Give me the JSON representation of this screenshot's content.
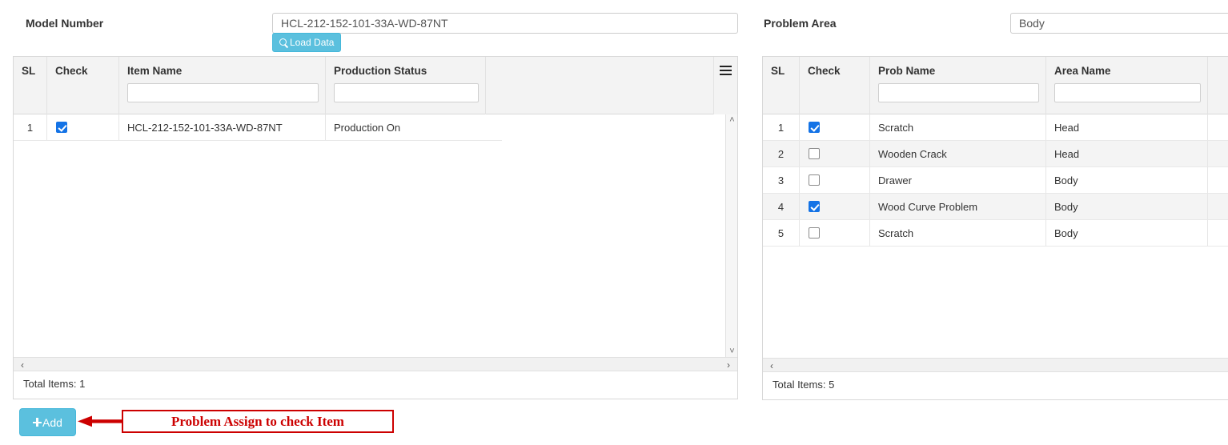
{
  "left_form": {
    "label": "Model Number",
    "value": "HCL-212-152-101-33A-WD-87NT",
    "placeholder": "",
    "load_button_label": "Load Data",
    "load_button_icon": "search-icon",
    "button_color": "#5bc0de"
  },
  "right_form": {
    "label": "Problem Area",
    "value": "Body",
    "placeholder": ""
  },
  "left_grid": {
    "menu_icon": "hamburger-menu-icon",
    "columns": [
      {
        "title": "SL",
        "filter": "",
        "has_filter": false
      },
      {
        "title": "Check",
        "filter": "",
        "has_filter": false
      },
      {
        "title": "Item Name",
        "filter": "",
        "has_filter": true
      },
      {
        "title": "Production Status",
        "filter": "",
        "has_filter": true
      }
    ],
    "rows": [
      {
        "sl": "1",
        "checked": true,
        "item_name": "HCL-212-152-101-33A-WD-87NT",
        "production_status": "Production On"
      }
    ],
    "footer": "Total Items: 1",
    "scroll_left_arrow": "‹",
    "scroll_right_arrow": "›",
    "scroll_up_arrow": "˄",
    "scroll_down_arrow": "˅"
  },
  "right_grid": {
    "columns": [
      {
        "title": "SL",
        "filter": "",
        "has_filter": false
      },
      {
        "title": "Check",
        "filter": "",
        "has_filter": false
      },
      {
        "title": "Prob Name",
        "filter": "",
        "has_filter": true
      },
      {
        "title": "Area Name",
        "filter": "",
        "has_filter": true
      }
    ],
    "rows": [
      {
        "sl": "1",
        "checked": true,
        "prob_name": "Scratch",
        "area_name": "Head"
      },
      {
        "sl": "2",
        "checked": false,
        "prob_name": "Wooden Crack",
        "area_name": "Head"
      },
      {
        "sl": "3",
        "checked": false,
        "prob_name": "Drawer",
        "area_name": "Body"
      },
      {
        "sl": "4",
        "checked": true,
        "prob_name": "Wood Curve Problem",
        "area_name": "Body"
      },
      {
        "sl": "5",
        "checked": false,
        "prob_name": "Scratch",
        "area_name": "Body"
      }
    ],
    "footer": "Total Items: 5",
    "scroll_left_arrow": "‹"
  },
  "actions": {
    "add_label": "Add",
    "add_icon": "plus-icon"
  },
  "annotation": {
    "text": "Problem Assign to check Item",
    "color": "#cc0000"
  }
}
